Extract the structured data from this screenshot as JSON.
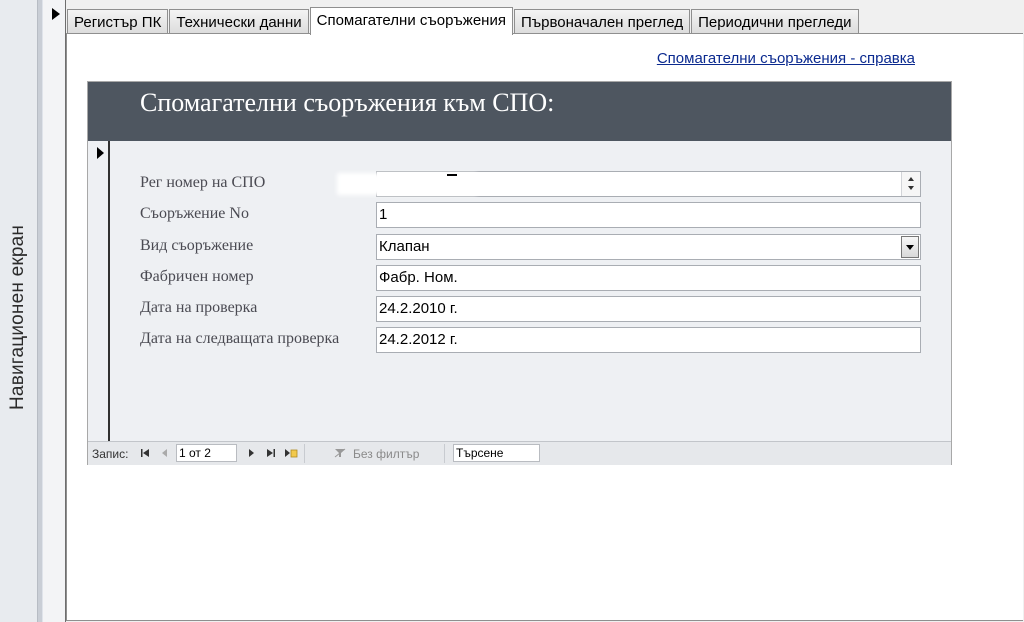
{
  "nav_pane": {
    "label": "Навигационен екран"
  },
  "tabs": [
    {
      "label": "Регистър ПК",
      "active": false
    },
    {
      "label": "Технически данни",
      "active": false
    },
    {
      "label": "Спомагателни съоръжения",
      "active": true
    },
    {
      "label": "Първоначален преглед",
      "active": false
    },
    {
      "label": "Периодични прегледи",
      "active": false
    }
  ],
  "help_link": "Спомагателни съоръжения - справка",
  "form": {
    "title": "Спомагателни съоръжения към СПО:",
    "fields": {
      "reg_no": {
        "label": "Рег номер на СПО",
        "value": ""
      },
      "item_no": {
        "label": "Съоръжение No",
        "value": "1"
      },
      "type": {
        "label": "Вид съоръжение",
        "value": "Клапан"
      },
      "serial": {
        "label": "Фабричен номер",
        "value": "Фабр. Ном."
      },
      "check": {
        "label": "Дата на проверка",
        "value": "24.2.2010 г."
      },
      "next": {
        "label": "Дата на следващата проверка",
        "value": "24.2.2012 г."
      }
    }
  },
  "record_nav": {
    "label": "Запис:",
    "position": "1 от 2",
    "filter": "Без филтър",
    "search": "Търсене"
  },
  "colors": {
    "header_bg": "#4e5660",
    "link": "#0b2a8f",
    "form_bg": "#eef0f3"
  },
  "icons": [
    "first-record-icon",
    "prev-record-icon",
    "next-record-icon",
    "last-record-icon",
    "new-record-icon",
    "filter-icon",
    "record-selector-icon",
    "dropdown-icon",
    "spinner-icon"
  ]
}
